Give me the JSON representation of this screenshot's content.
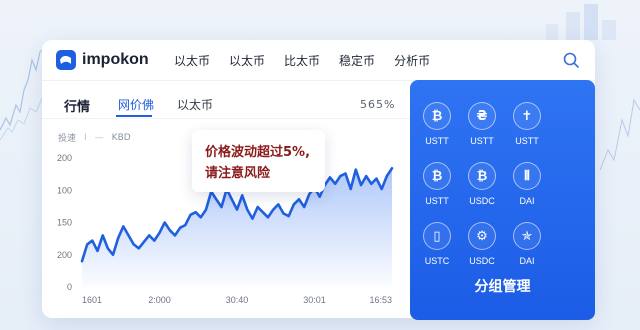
{
  "brand": {
    "name": "impokon"
  },
  "nav": [
    "以太币",
    "以太币",
    "比太币",
    "稳定币",
    "分析币"
  ],
  "tabs": {
    "main": "行情",
    "active": "网价佛",
    "third": "以太币"
  },
  "percent": "565%",
  "legend": {
    "label": "投速",
    "sep1": "I",
    "sep2": "—",
    "unit": "KBD"
  },
  "tooltip": {
    "line1": "价格波动超过5%,",
    "line2": "请注意风险"
  },
  "panel": {
    "coins": [
      {
        "label": "USTT",
        "icon": "bitcoin-icon",
        "glyph": "₿"
      },
      {
        "label": "USTT",
        "icon": "tether-icon",
        "glyph": "₴"
      },
      {
        "label": "USTT",
        "icon": "cross-icon",
        "glyph": "✝"
      },
      {
        "label": "USTT",
        "icon": "bitcoin-icon",
        "glyph": "₿"
      },
      {
        "label": "USDC",
        "icon": "bitcoin-icon",
        "glyph": "₿"
      },
      {
        "label": "DAI",
        "icon": "bars-icon",
        "glyph": "⦀"
      },
      {
        "label": "USTC",
        "icon": "chip-icon",
        "glyph": "▯"
      },
      {
        "label": "USDC",
        "icon": "gear-icon",
        "glyph": "⚙"
      },
      {
        "label": "DAI",
        "icon": "star-icon",
        "glyph": "✯"
      }
    ],
    "button": "分组管理"
  },
  "colors": {
    "accent": "#1f5fe0",
    "panel": "#2467ec",
    "warning": "#8b1a1a"
  },
  "chart_data": {
    "type": "area",
    "y_tick_labels": [
      "200",
      "100",
      "150",
      "200",
      "0"
    ],
    "x_tick_labels": [
      "1601",
      "2:000",
      "30:40",
      "30:01",
      "16:53"
    ],
    "x": [
      0,
      1,
      2,
      3,
      4,
      5,
      6,
      7,
      8,
      9,
      10,
      11,
      12,
      13,
      14,
      15,
      16,
      17,
      18,
      19,
      20,
      21,
      22,
      23,
      24,
      25,
      26,
      27,
      28,
      29,
      30,
      31,
      32,
      33,
      34,
      35,
      36,
      37,
      38,
      39,
      40,
      41,
      42,
      43,
      44,
      45,
      46,
      47,
      48,
      49,
      50,
      51,
      52,
      53,
      54,
      55,
      56,
      57,
      58,
      59,
      60
    ],
    "values": [
      0.2,
      0.33,
      0.36,
      0.28,
      0.4,
      0.3,
      0.25,
      0.38,
      0.47,
      0.4,
      0.33,
      0.3,
      0.35,
      0.4,
      0.36,
      0.42,
      0.5,
      0.44,
      0.4,
      0.46,
      0.48,
      0.56,
      0.58,
      0.54,
      0.6,
      0.74,
      0.68,
      0.62,
      0.76,
      0.68,
      0.6,
      0.71,
      0.6,
      0.53,
      0.62,
      0.58,
      0.54,
      0.6,
      0.64,
      0.57,
      0.55,
      0.64,
      0.68,
      0.62,
      0.72,
      0.77,
      0.7,
      0.79,
      0.85,
      0.8,
      0.86,
      0.88,
      0.76,
      0.91,
      0.79,
      0.86,
      0.8,
      0.84,
      0.76,
      0.86,
      0.92
    ],
    "ylim": [
      0,
      1
    ],
    "grid": false
  }
}
